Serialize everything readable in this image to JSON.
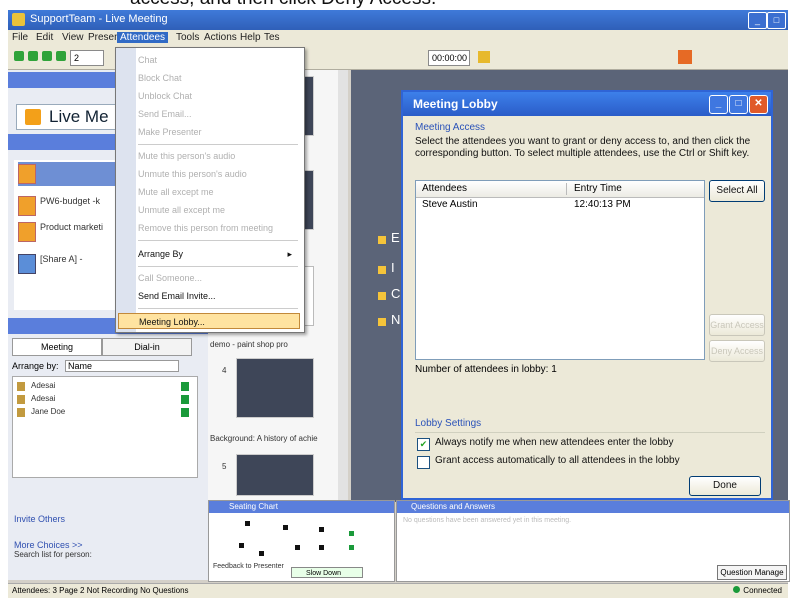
{
  "instruction": "access, and then click Deny Access.",
  "window": {
    "title": "SupportTeam - Live Meeting"
  },
  "menubar": [
    "File",
    "Edit",
    "View",
    "Present",
    "Attendees",
    "Tools",
    "Actions",
    "Help",
    "Tes"
  ],
  "toolbar": {
    "page_num": "2",
    "time": "00:00:00"
  },
  "left_pane": {
    "banner": "Live Me",
    "resources": [
      {
        "name": "PW6-budget -k",
        "sub": "",
        "selected": false
      },
      {
        "name": "Product marketi",
        "sub": "",
        "selected": false
      },
      {
        "name": "[Share A] -",
        "sub": "",
        "selected": false
      }
    ],
    "attendee_tabs": [
      "Meeting",
      "Dial-in"
    ],
    "arrange_by": "Arrange by:",
    "arrange_value": "Name",
    "attendees": [
      "Adesai",
      "Adesai",
      "Jane Doe"
    ],
    "invite": "Invite Others",
    "more_choices": "More Choices >>",
    "search_label": "Search list for person:"
  },
  "dropdown": {
    "items": [
      {
        "label": "Chat",
        "enabled": false
      },
      {
        "label": "Block Chat",
        "enabled": false
      },
      {
        "label": "Unblock Chat",
        "enabled": false
      },
      {
        "label": "Send Email...",
        "enabled": false
      },
      {
        "label": "Make Presenter",
        "enabled": false
      },
      {
        "label": "Mute this person's audio",
        "enabled": false
      },
      {
        "label": "Unmute this person's audio",
        "enabled": false
      },
      {
        "label": "Mute all except me",
        "enabled": false
      },
      {
        "label": "Unmute all except me",
        "enabled": false
      },
      {
        "label": "Remove this person from meeting",
        "enabled": false
      },
      {
        "label": "Arrange By",
        "enabled": true
      },
      {
        "label": "Call Someone...",
        "enabled": false
      },
      {
        "label": "Send Email Invite...",
        "enabled": true
      },
      {
        "label": "Meeting Lobby...",
        "enabled": true
      }
    ]
  },
  "slides": {
    "labels": [
      "demo - paint shop pro",
      "Background: A history of achie"
    ],
    "numbers": [
      "4",
      "5"
    ]
  },
  "main": {
    "bullets": [
      "E",
      "I",
      "C",
      "N"
    ]
  },
  "lobby": {
    "title": "Meeting Lobby",
    "section_access": "Meeting Access",
    "description": "Select the attendees you want to grant or deny access to, and then click the corresponding button. To select multiple attendees, use the Ctrl or Shift key.",
    "col_attendees": "Attendees",
    "col_entry": "Entry Time",
    "row_name": "Steve Austin",
    "row_time": "12:40:13 PM",
    "btn_select_all": "Select All",
    "btn_grant": "Grant Access",
    "btn_deny": "Deny Access",
    "count": "Number of attendees in lobby: 1",
    "section_settings": "Lobby Settings",
    "chk1": "Always notify me when new attendees enter the lobby",
    "chk2": "Grant access automatically to all attendees in the lobby",
    "btn_done": "Done"
  },
  "poll": {
    "title": "Seating Chart",
    "feedback": "Feedback to Presenter",
    "slowdown": "Slow Down"
  },
  "qa": {
    "title": "Questions and Answers",
    "empty": "No questions have been answered yet in this meeting.",
    "manage": "Question Manage"
  },
  "statusbar": {
    "text": "Attendees: 3   Page 2   Not Recording   No Questions",
    "connected": "Connected"
  }
}
